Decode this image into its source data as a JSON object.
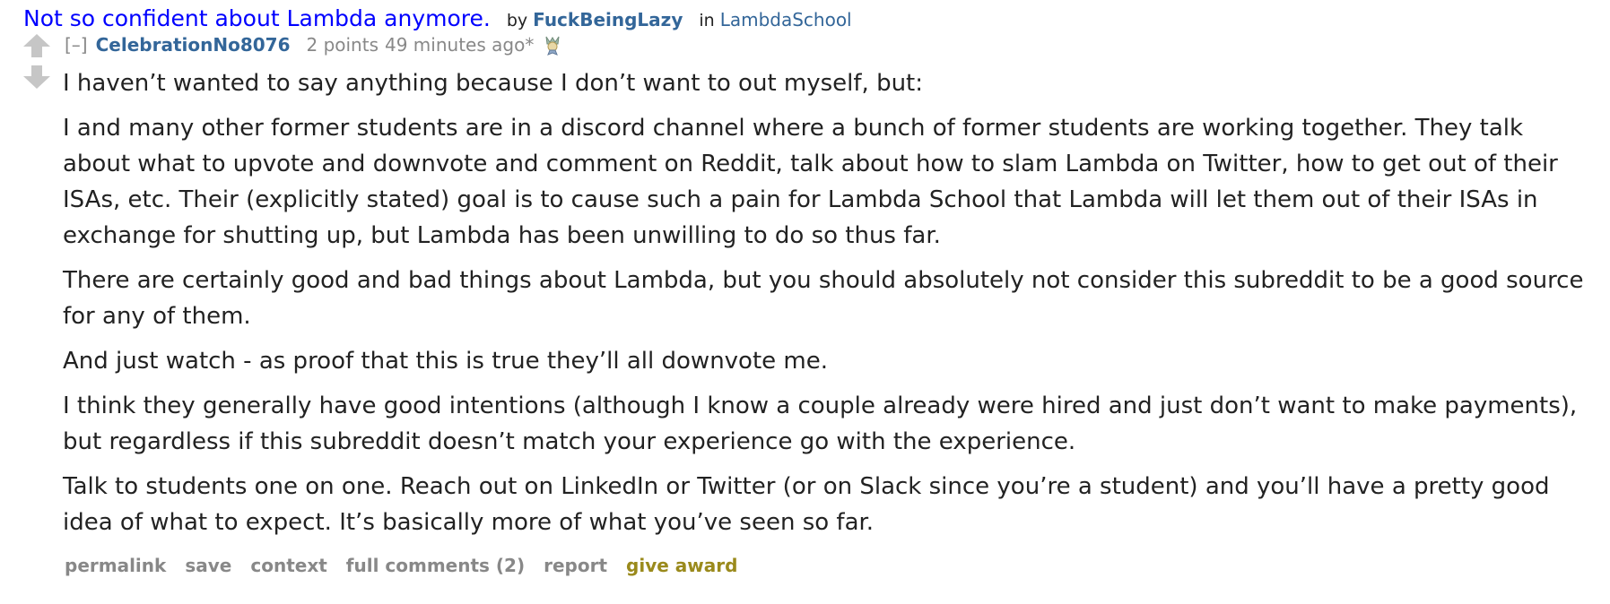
{
  "post": {
    "title": "Not so confident about Lambda anymore.",
    "by_label": "by",
    "author": "FuckBeingLazy",
    "in_label": "in",
    "subreddit": "LambdaSchool"
  },
  "comment": {
    "collapse_label": "[–]",
    "author": "CelebrationNo8076",
    "score": "2 points",
    "timestamp": "49 minutes ago",
    "edited_mark": "*",
    "flair_icon": "award-flair-icon",
    "paragraphs": [
      "I haven’t wanted to say anything because I don’t want to out myself, but:",
      "I and many other former students are in a discord channel where a bunch of former students are working together. They talk about what to upvote and downvote and comment on Reddit, talk about how to slam Lambda on Twitter, how to get out of their ISAs, etc. Their (explicitly stated) goal is to cause such a pain for Lambda School that Lambda will let them out of their ISAs in exchange for shutting up, but Lambda has been unwilling to do so thus far.",
      "There are certainly good and bad things about Lambda, but you should absolutely not consider this subreddit to be a good source for any of them.",
      "And just watch - as proof that this is true they’ll all downvote me.",
      "I think they generally have good intentions (although I know a couple already were hired and just don’t want to make payments), but regardless if this subreddit doesn’t match your experience go with the experience.",
      "Talk to students one on one. Reach out on LinkedIn or Twitter (or on Slack since you’re a student) and you’ll have a pretty good idea of what to expect. It’s basically more of what you’ve seen so far."
    ]
  },
  "actions": {
    "permalink": "permalink",
    "save": "save",
    "context": "context",
    "full_comments": "full comments (2)",
    "report": "report",
    "give_award": "give award"
  },
  "colors": {
    "title_link": "#0000ff",
    "author_link": "#336699",
    "muted": "#888888",
    "award": "#9a8a1c"
  }
}
